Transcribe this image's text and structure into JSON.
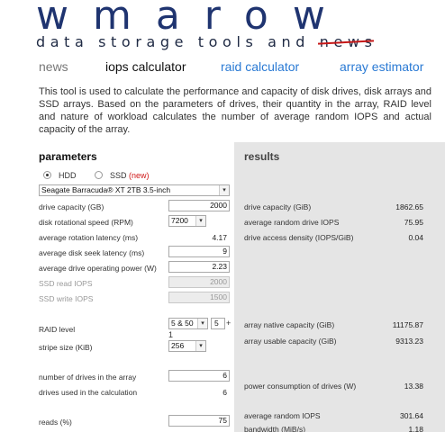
{
  "brand": {
    "logo": "wmarow",
    "tagline_pre": "data storage tools and ",
    "tagline_struck": "news"
  },
  "nav": [
    "news",
    "iops calculator",
    "raid calculator",
    "array estimator"
  ],
  "intro": "This tool is used to calculate the performance and capacity of disk drives, disk arrays and SSD arrays. Based on the parameters of drives, their quantity in the array, RAID level and nature of workload calculates the number of average random IOPS and actual capacity of the array.",
  "params": {
    "heading": "parameters",
    "drive_type": {
      "hdd": "HDD",
      "ssd": "SSD",
      "new_badge": "(new)",
      "selected": "HDD"
    },
    "drive_model": "Seagate Barracuda® XT 2TB 3.5-inch",
    "rows": [
      {
        "label": "drive capacity (GB)",
        "value": "2000",
        "kind": "input"
      },
      {
        "label": "disk rotational speed (RPM)",
        "value": "7200",
        "kind": "select"
      },
      {
        "label": "average rotation latency (ms)",
        "value": "4.17",
        "kind": "text"
      },
      {
        "label": "average disk seek latency (ms)",
        "value": "9",
        "kind": "input"
      },
      {
        "label": "average drive operating power (W)",
        "value": "2.23",
        "kind": "input"
      },
      {
        "label": "SSD read IOPS",
        "value": "2000",
        "kind": "disabled"
      },
      {
        "label": "SSD write IOPS",
        "value": "1500",
        "kind": "disabled"
      }
    ],
    "raid_level": {
      "label": "RAID level",
      "value": "5 & 50",
      "group_value": "5",
      "extra": "+",
      "note": "1"
    },
    "stripe_size": {
      "label": "stripe size (KiB)",
      "value": "256"
    },
    "num_drives": {
      "label": "number of drives in the array",
      "value": "6"
    },
    "drives_used": {
      "label": "drives used in the calculation",
      "value": "6"
    },
    "reads": {
      "label": "reads (%)",
      "value": "75"
    }
  },
  "results": {
    "heading": "results",
    "rows": [
      {
        "label": "drive capacity (GiB)",
        "value": "1862.65"
      },
      {
        "label": "average random drive IOPS",
        "value": "75.95"
      },
      {
        "label": "drive access density (IOPS/GiB)",
        "value": "0.04"
      },
      {
        "label": "array native capacity (GiB)",
        "value": "11175.87"
      },
      {
        "label": "array usable capacity (GiB)",
        "value": "9313.23"
      },
      {
        "label": "power consumption of drives (W)",
        "value": "13.38"
      },
      {
        "label": "average random IOPS",
        "value": "301.64"
      },
      {
        "label": "bandwidth (MiB/s)",
        "value": "1.18"
      }
    ]
  },
  "colors": {
    "brand_blue": "#1f3470",
    "link_blue": "#2a7ad4",
    "results_bg": "#e5e5e5",
    "accent_red": "#d01818"
  }
}
